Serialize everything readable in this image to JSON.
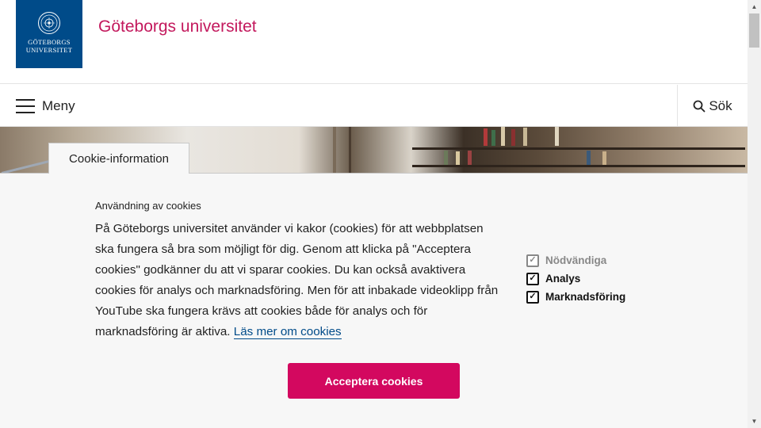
{
  "header": {
    "logo_line1": "GÖTEBORGS",
    "logo_line2": "UNIVERSITET",
    "site_name": "Göteborgs universitet"
  },
  "nav": {
    "menu_label": "Meny",
    "menu_icon": "hamburger-icon",
    "search_label": "Sök",
    "search_icon": "search-icon"
  },
  "cookie": {
    "tab_label": "Cookie-information",
    "heading": "Användning av cookies",
    "body": "På Göteborgs universitet använder vi kakor (cookies) för att webbplatsen ska fungera så bra som möjligt för dig. Genom att klicka på \"Acceptera cookies\" godkänner du att vi sparar cookies. Du kan också avaktivera cookies för analys och marknadsföring. Men för att inbakade videoklipp från YouTube ska fungera krävs att cookies både för analys och för marknadsföring är aktiva.",
    "link_text": "Läs mer om cookies",
    "options": [
      {
        "label": "Nödvändiga",
        "checked": true,
        "disabled": true
      },
      {
        "label": "Analys",
        "checked": true,
        "disabled": false
      },
      {
        "label": "Marknadsföring",
        "checked": true,
        "disabled": false
      }
    ],
    "accept_label": "Acceptera cookies"
  },
  "colors": {
    "brand_blue": "#004b89",
    "brand_pink": "#c3195d",
    "accept_button": "#d3085f"
  }
}
